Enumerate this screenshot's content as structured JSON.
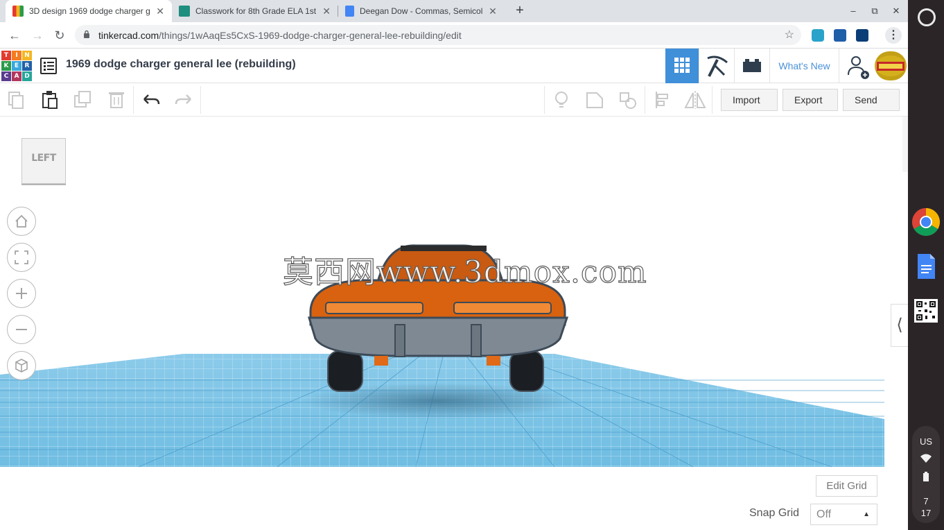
{
  "browser": {
    "tabs": [
      {
        "title": "3D design 1969 dodge charger g",
        "favicon": "tinkercad-favicon",
        "active": true
      },
      {
        "title": "Classwork for 8th Grade ELA 1st",
        "favicon": "classroom-favicon",
        "active": false
      },
      {
        "title": "Deegan Dow - Commas, Semicol",
        "favicon": "docs-favicon",
        "active": false
      }
    ],
    "new_tab_icon": "+",
    "window_controls": {
      "minimize": "–",
      "restore": "⧉",
      "close": "✕"
    },
    "url_host": "tinkercad.com",
    "url_path": "/things/1wAaqEs5CxS-1969-dodge-charger-general-lee-rebuilding/edit",
    "nav": {
      "back": "←",
      "forward": "→",
      "reload": "↻"
    },
    "star_icon": "☆",
    "menu_icon": "⋮"
  },
  "header": {
    "logo_letters": [
      "TIN",
      "KER",
      "CAD"
    ],
    "logo_colors": [
      "#e23b2e",
      "#f47b20",
      "#f4b622",
      "#2a9b4a",
      "#3aa7dd",
      "#2161a8",
      "#5a3b8e",
      "#b2375e",
      "#26a69a"
    ],
    "design_title": "1969 dodge charger general lee (rebuilding)",
    "whats_new": "What's New",
    "accent": "#3f8fd9"
  },
  "toolbar": {
    "import": "Import",
    "export": "Export",
    "send_to": "Send To"
  },
  "workplane": {
    "view_cube_label": "LEFT",
    "watermark": "莫西网www.3dmox.com",
    "edit_grid": "Edit Grid",
    "snap_grid_label": "Snap Grid",
    "snap_grid_value": "Off",
    "side_toggle": "⟨",
    "grid_color": "#5ab0dc",
    "car_color": "#d8620f"
  },
  "shelf": {
    "locale": "US",
    "time_hour": "7",
    "time_minute": "17"
  }
}
